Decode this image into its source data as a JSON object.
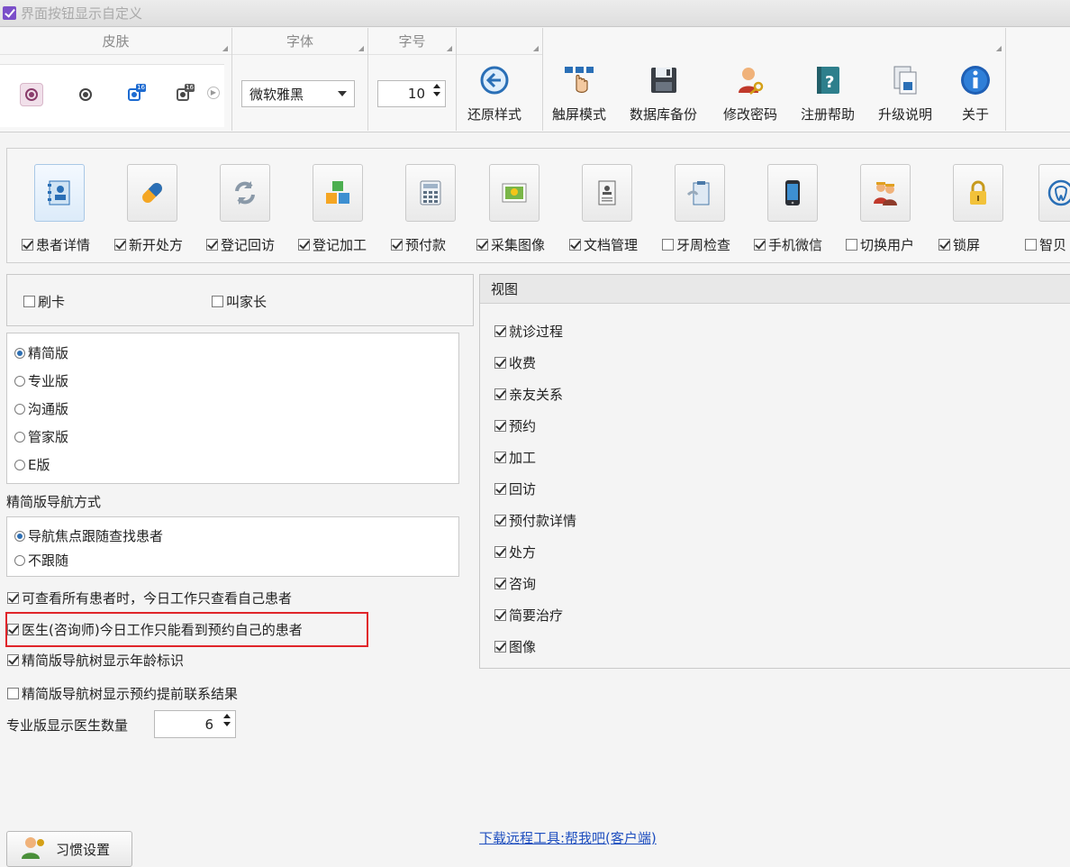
{
  "window": {
    "title": "界面按钮显示自定义",
    "title_checked": true
  },
  "ribbon": {
    "skin_group_label": "皮肤",
    "font_group_label": "字体",
    "size_group_label": "字号",
    "font_value": "微软雅黑",
    "size_value": "10",
    "buttons": [
      {
        "label": "还原样式",
        "icon": "restore-icon"
      },
      {
        "label": "触屏模式",
        "icon": "touch-icon"
      },
      {
        "label": "数据库备份",
        "icon": "floppy-disk-icon"
      },
      {
        "label": "修改密码",
        "icon": "user-key-icon"
      },
      {
        "label": "注册帮助",
        "icon": "help-book-icon"
      },
      {
        "label": "升级说明",
        "icon": "upgrade-doc-icon"
      },
      {
        "label": "关于",
        "icon": "info-icon"
      }
    ]
  },
  "toolbar": {
    "items": [
      {
        "label": "患者详情",
        "checked": true,
        "icon": "patient-card-icon"
      },
      {
        "label": "新开处方",
        "checked": true,
        "icon": "pill-icon"
      },
      {
        "label": "登记回访",
        "checked": true,
        "icon": "refresh-icon"
      },
      {
        "label": "登记加工",
        "checked": true,
        "icon": "cubes-icon"
      },
      {
        "label": "预付款",
        "checked": true,
        "icon": "calculator-icon"
      },
      {
        "label": "采集图像",
        "checked": true,
        "icon": "image-icon"
      },
      {
        "label": "文档管理",
        "checked": true,
        "icon": "document-icon"
      },
      {
        "label": "牙周检查",
        "checked": false,
        "icon": "clipboard-icon"
      },
      {
        "label": "手机微信",
        "checked": true,
        "icon": "phone-icon"
      },
      {
        "label": "切换用户",
        "checked": false,
        "icon": "users-icon"
      },
      {
        "label": "锁屏",
        "checked": true,
        "icon": "lock-icon"
      },
      {
        "label": "智贝",
        "checked": false,
        "icon": "tooth-icon"
      }
    ]
  },
  "options": {
    "card_swipe": {
      "label": "刷卡",
      "checked": false
    },
    "call_parent": {
      "label": "叫家长",
      "checked": false
    },
    "editions": [
      {
        "label": "精简版",
        "selected": true
      },
      {
        "label": "专业版",
        "selected": false
      },
      {
        "label": "沟通版",
        "selected": false
      },
      {
        "label": "管家版",
        "selected": false
      },
      {
        "label": "E版",
        "selected": false
      }
    ],
    "nav_mode_label": "精简版导航方式",
    "nav_modes": [
      {
        "label": "导航焦点跟随查找患者",
        "selected": true
      },
      {
        "label": "不跟随",
        "selected": false
      }
    ],
    "checks": [
      {
        "label": "可查看所有患者时，今日工作只查看自己患者",
        "checked": true
      },
      {
        "label": "医生(咨询师)今日工作只能看到预约自己的患者",
        "checked": true
      },
      {
        "label": "精简版导航树显示年龄标识",
        "checked": true
      },
      {
        "label": "精简版导航树显示预约提前联系结果",
        "checked": false
      }
    ],
    "doctor_count_label": "专业版显示医生数量",
    "doctor_count_value": "6"
  },
  "view": {
    "title": "视图",
    "items": [
      {
        "label": "就诊过程",
        "checked": true
      },
      {
        "label": "收费",
        "checked": true
      },
      {
        "label": "亲友关系",
        "checked": true
      },
      {
        "label": "预约",
        "checked": true
      },
      {
        "label": "加工",
        "checked": true
      },
      {
        "label": "回访",
        "checked": true
      },
      {
        "label": "预付款详情",
        "checked": true
      },
      {
        "label": "处方",
        "checked": true
      },
      {
        "label": "咨询",
        "checked": true
      },
      {
        "label": "简要治疗",
        "checked": true
      },
      {
        "label": "图像",
        "checked": true
      }
    ]
  },
  "footer": {
    "habit_button": "习惯设置",
    "remote_link": "下载远程工具:帮我吧(客户端)"
  },
  "colors": {
    "highlight_border": "#e0252a",
    "link": "#1f4fbf",
    "accent": "#7b4fc9"
  }
}
